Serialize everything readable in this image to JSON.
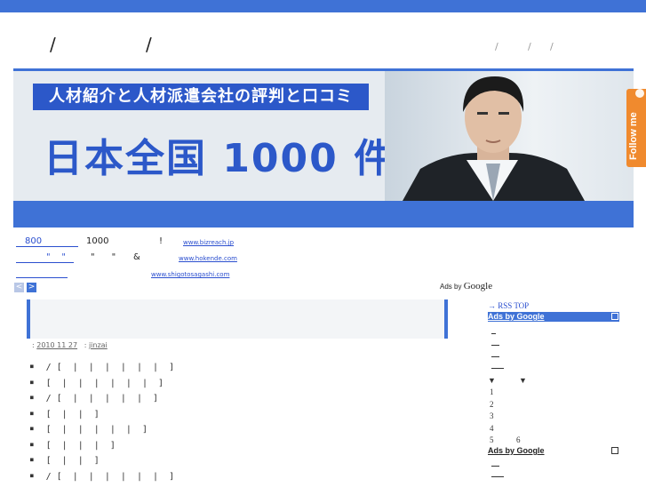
{
  "header": {
    "title_parts": [
      "/",
      "/"
    ],
    "sub_parts": [
      "/",
      "/",
      "/"
    ]
  },
  "banner": {
    "tagline": "人材紹介と人材派遣会社の評判と口コミ",
    "headline": "日本全国 1000 件"
  },
  "follow": {
    "label": "Follow me"
  },
  "ads": [
    {
      "link": "800",
      "text": "1000",
      "mark": "!",
      "url": "www.bizreach.jp"
    },
    {
      "link": "\"    \"",
      "text": "\"      \"",
      "mark": "&",
      "url": "www.hokende.com"
    },
    {
      "link": "",
      "text": "",
      "mark": "",
      "url": "www.shigotosagashi.com"
    }
  ],
  "pager": {
    "prev": "<",
    "next": ">"
  },
  "adsby": {
    "prefix": "Ads by",
    "brand": "Google"
  },
  "post": {
    "date": "2010 11 27",
    "author": "jinzai",
    "items": [
      "/ [  |  |  |  |  |  |  ]",
      "[  |  |  |  |  |  |  ]",
      "/ [  |  |  |  |  |  ]",
      "[  |  |  ]",
      "[  |  |  |  |  |  ]",
      "[  |  |  |  ]",
      "[  |  |  ]",
      "/ [  |  |  |  |  |  |  ]"
    ]
  },
  "sidebar": {
    "rss": "→ RSS TOP",
    "ads_label": "Ads by Google",
    "arrows": [
      "▼",
      "▼"
    ],
    "numbers": [
      "1",
      "2",
      "3",
      "4",
      "5",
      "6"
    ],
    "ads_label2": "Ads by Google"
  },
  "colors": {
    "brand_blue": "#3f72d6",
    "follow_orange": "#f08a2e"
  }
}
